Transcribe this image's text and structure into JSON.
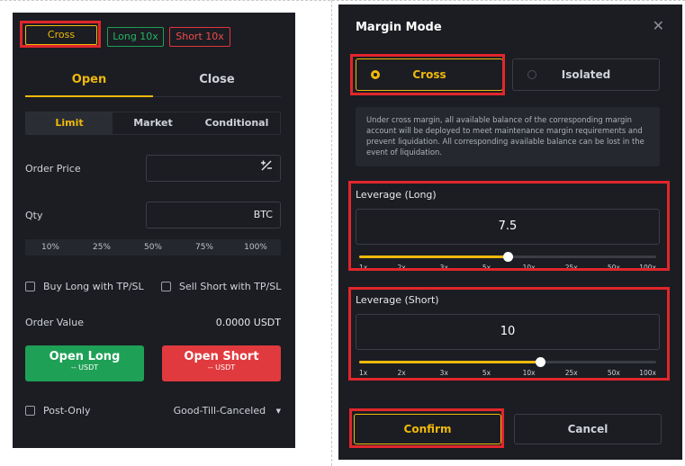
{
  "left_panel": {
    "margin_mode_button": "Cross",
    "long_leverage_button": "Long 10x",
    "short_leverage_button": "Short 10x",
    "tabs": [
      "Open",
      "Close"
    ],
    "order_types": [
      "Limit",
      "Market",
      "Conditional"
    ],
    "order_price_label": "Order Price",
    "qty_label": "Qty",
    "qty_unit": "BTC",
    "percent_options": [
      "10%",
      "25%",
      "50%",
      "75%",
      "100%"
    ],
    "buy_long_tpsl": "Buy Long with TP/SL",
    "sell_short_tpsl": "Sell Short with TP/SL",
    "order_value_label": "Order Value",
    "order_value": "0.0000 USDT",
    "open_long": {
      "label": "Open Long",
      "sub": "-- USDT"
    },
    "open_short": {
      "label": "Open Short",
      "sub": "-- USDT"
    },
    "post_only": "Post-Only",
    "time_in_force": "Good-Till-Canceled",
    "colors": {
      "accent": "#f0b90b",
      "long": "#1ea056",
      "short": "#e13a3e",
      "highlight": "#e1262c"
    }
  },
  "dialog": {
    "title": "Margin Mode",
    "close_icon": "close-icon",
    "modes": [
      "Cross",
      "Isolated"
    ],
    "selected_mode": "Cross",
    "info_text": "Under cross margin, all available balance of the corresponding margin account will be deployed to meet maintenance margin requirements and prevent liquidation. All corresponding available balance can be lost in the event of liquidation.",
    "leverage_long": {
      "label": "Leverage (Long)",
      "value": "7.5",
      "slider_fraction": 0.5
    },
    "leverage_short": {
      "label": "Leverage (Short)",
      "value": "10",
      "slider_fraction": 0.61
    },
    "slider_ticks": [
      "1x",
      "2x",
      "3x",
      "5x",
      "10x",
      "25x",
      "50x",
      "100x"
    ],
    "confirm": "Confirm",
    "cancel": "Cancel"
  }
}
